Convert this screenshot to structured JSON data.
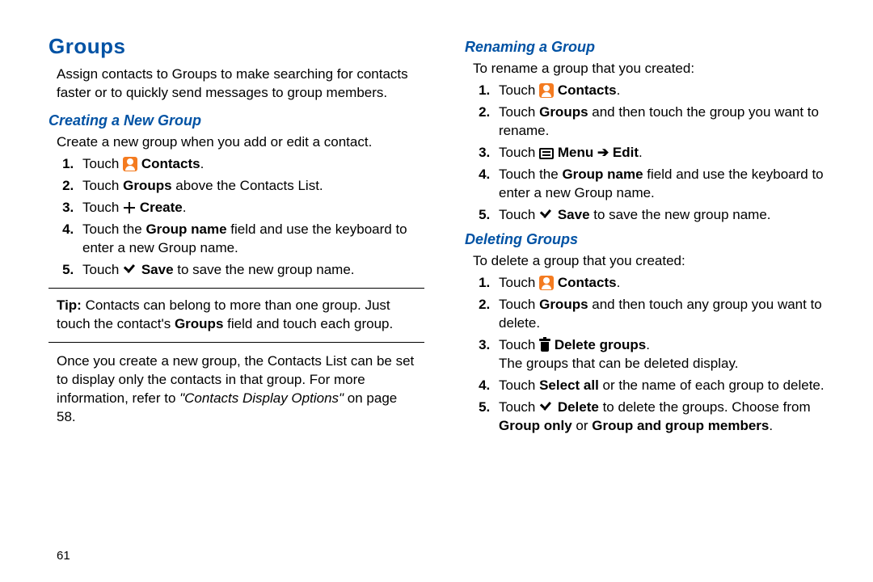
{
  "left": {
    "h1": "Groups",
    "intro": "Assign contacts to Groups to make searching for contacts faster or to quickly send messages to group members.",
    "h2": "Creating a New Group",
    "lead": "Create a new group when you add or edit a contact.",
    "s1_touch": "Touch ",
    "s1_label": "Contacts",
    "s2_a": "Touch ",
    "s2_b": "Groups",
    "s2_c": " above the Contacts List.",
    "s3_touch": "Touch ",
    "s3_label": "Create",
    "s4_a": "Touch the ",
    "s4_b": "Group name",
    "s4_c": " field and use the keyboard to enter a new Group name.",
    "s5_touch": "Touch ",
    "s5_label": "Save",
    "s5_c": " to save the new group name.",
    "tip_a": "Tip:",
    "tip_b": " Contacts can belong to more than one group. Just touch the contact's ",
    "tip_c": "Groups",
    "tip_d": " field and touch each group.",
    "post_a": "Once you create a new group, the Contacts List can be set to display only the contacts in that group. For more information, refer to ",
    "post_ref": "\"Contacts Display Options\"",
    "post_b": " on page 58."
  },
  "right": {
    "r_h2": "Renaming a Group",
    "r_lead": "To rename a group that you created:",
    "r1_touch": "Touch ",
    "r1_label": "Contacts",
    "r2_a": "Touch ",
    "r2_b": "Groups",
    "r2_c": " and then touch the group you want to rename.",
    "r3_touch": "Touch ",
    "r3_menu": "Menu",
    "r3_arrow": " ➔ ",
    "r3_edit": "Edit",
    "r4_a": "Touch the ",
    "r4_b": "Group name",
    "r4_c": " field and use the keyboard to enter a new Group name.",
    "r5_touch": "Touch ",
    "r5_label": "Save",
    "r5_c": " to save the new group name.",
    "d_h2": "Deleting Groups",
    "d_lead": "To delete a group that you created:",
    "d1_touch": "Touch ",
    "d1_label": "Contacts",
    "d2_a": "Touch ",
    "d2_b": "Groups",
    "d2_c": " and then touch any group you want to delete.",
    "d3_touch": "Touch ",
    "d3_label": "Delete groups",
    "d3_c": "The groups that can be deleted display.",
    "d4_a": "Touch ",
    "d4_b": "Select all",
    "d4_c": " or the name of each group to delete.",
    "d5_touch": "Touch ",
    "d5_label": "Delete",
    "d5_c": " to delete the groups. Choose from ",
    "d5_d": "Group only",
    "d5_e": " or ",
    "d5_f": "Group and group members"
  },
  "page_number": "61"
}
